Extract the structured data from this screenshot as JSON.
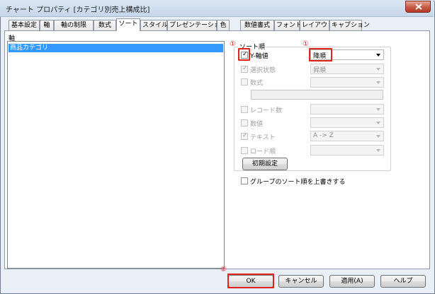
{
  "window": {
    "title": "チャート プロパティ [カテゴリ別売上構成比]"
  },
  "tabs": [
    {
      "label": "基本設定",
      "active": false
    },
    {
      "label": "軸",
      "active": false
    },
    {
      "label": "軸の制限",
      "active": false
    },
    {
      "label": "数式",
      "active": false
    },
    {
      "label": "ソート",
      "active": true
    },
    {
      "label": "スタイル",
      "active": false
    },
    {
      "label": "プレゼンテーション",
      "active": false
    },
    {
      "label": "色",
      "active": false
    },
    {
      "label": "数値書式",
      "active": false
    },
    {
      "label": "フォント",
      "active": false
    },
    {
      "label": "レイアウト",
      "active": false
    },
    {
      "label": "キャプション",
      "active": false
    }
  ],
  "axis_panel": {
    "label": "軸",
    "items": [
      "商品カテゴリ"
    ]
  },
  "sort_group": {
    "legend": "ソート順",
    "options": [
      {
        "label": "Y-軸値",
        "checked": true,
        "enabled": true,
        "combo": "降順"
      },
      {
        "label": "選択状態",
        "checked": true,
        "enabled": false,
        "combo": "昇順"
      },
      {
        "label": "数式",
        "checked": false,
        "enabled": false,
        "combo": ""
      },
      {
        "label": "レコード数",
        "checked": false,
        "enabled": false,
        "combo": ""
      },
      {
        "label": "数値",
        "checked": false,
        "enabled": false,
        "combo": ""
      },
      {
        "label": "テキスト",
        "checked": true,
        "enabled": false,
        "combo": "A -> Z"
      },
      {
        "label": "ロード順",
        "checked": false,
        "enabled": false,
        "combo": ""
      }
    ],
    "reset_button": "初期設定"
  },
  "override_group_sort": {
    "label": "グループのソート順を上書きする",
    "checked": false
  },
  "buttons": {
    "ok": "OK",
    "cancel": "キャンセル",
    "apply": "適用(A)",
    "help": "ヘルプ"
  },
  "annotations": {
    "marker_1": "①",
    "marker_2": "②"
  },
  "colors": {
    "highlight": "#e0231b",
    "selection": "#3399ff"
  }
}
